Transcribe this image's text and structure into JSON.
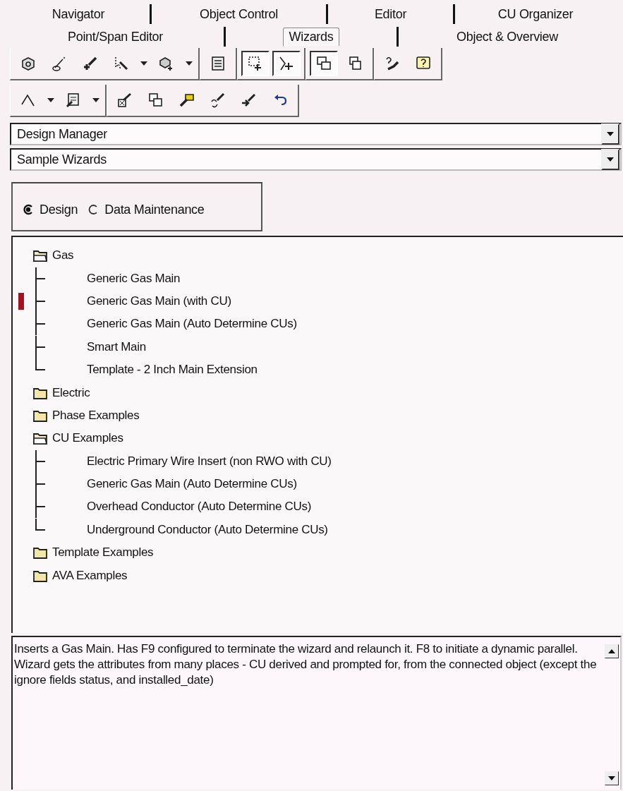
{
  "tab_rows": [
    [
      {
        "label": "Navigator",
        "selected": false
      },
      {
        "label": "Object Control",
        "selected": false
      },
      {
        "label": "Editor",
        "selected": false
      },
      {
        "label": "CU Organizer",
        "selected": false
      }
    ],
    [
      {
        "label": "Point/Span Editor",
        "selected": false
      },
      {
        "label": "Wizards",
        "selected": true
      },
      {
        "label": "Object & Overview",
        "selected": false
      }
    ]
  ],
  "toolbars": [
    [
      [
        {
          "pressed": false,
          "menu": false
        },
        {
          "pressed": false,
          "menu": false
        },
        {
          "pressed": false,
          "menu": false
        },
        {
          "pressed": false,
          "menu": true
        },
        {
          "pressed": false,
          "menu": true
        }
      ],
      [
        {
          "pressed": false,
          "menu": false
        }
      ],
      [
        {
          "pressed": true,
          "menu": false
        },
        {
          "pressed": true,
          "menu": false
        }
      ],
      [
        {
          "pressed": true,
          "menu": false
        },
        {
          "pressed": false,
          "menu": false
        }
      ],
      [
        {
          "pressed": false,
          "menu": false
        },
        {
          "pressed": false,
          "menu": false
        }
      ]
    ],
    [
      [
        {
          "pressed": false,
          "menu": true
        },
        {
          "pressed": false,
          "menu": true
        }
      ],
      [
        {
          "pressed": false,
          "menu": false
        },
        {
          "pressed": false,
          "menu": false
        },
        {
          "pressed": false,
          "menu": false
        },
        {
          "pressed": false,
          "menu": false
        },
        {
          "pressed": false,
          "menu": false
        },
        {
          "pressed": false,
          "menu": false
        }
      ]
    ]
  ],
  "combos": [
    {
      "value": "Design Manager"
    },
    {
      "value": "Sample Wizards"
    }
  ],
  "mode": [
    {
      "label": "Design",
      "selected": true
    },
    {
      "label": "Data Maintenance",
      "selected": false
    }
  ],
  "tree": [
    {
      "label": "Gas",
      "expanded": true,
      "children": [
        {
          "label": "Generic Gas Main",
          "selected": false
        },
        {
          "label": "Generic Gas Main (with CU)",
          "selected": true
        },
        {
          "label": "Generic Gas Main (Auto Determine CUs)",
          "selected": false
        },
        {
          "label": "Smart Main",
          "selected": false
        },
        {
          "label": "Template - 2 Inch Main Extension",
          "selected": false
        }
      ]
    },
    {
      "label": "Electric",
      "expanded": false
    },
    {
      "label": "Phase Examples",
      "expanded": false
    },
    {
      "label": "CU Examples",
      "expanded": true,
      "children": [
        {
          "label": "Electric Primary Wire Insert (non RWO with CU)",
          "selected": false
        },
        {
          "label": "Generic Gas Main (Auto Determine CUs)",
          "selected": false
        },
        {
          "label": "Overhead Conductor (Auto Determine CUs)",
          "selected": false
        },
        {
          "label": "Underground Conductor (Auto Determine CUs)",
          "selected": false
        }
      ]
    },
    {
      "label": "Template Examples",
      "expanded": false
    },
    {
      "label": "AVA Examples",
      "expanded": false
    }
  ],
  "description": "Inserts a Gas Main.  Has F9 configured to  terminate the wizard and relaunch it.  F8 to initiate a dynamic parallel.  Wizard gets the attributes from many places - CU derived and prompted for, from the connected object (except the ignore fields status, and installed_date)"
}
